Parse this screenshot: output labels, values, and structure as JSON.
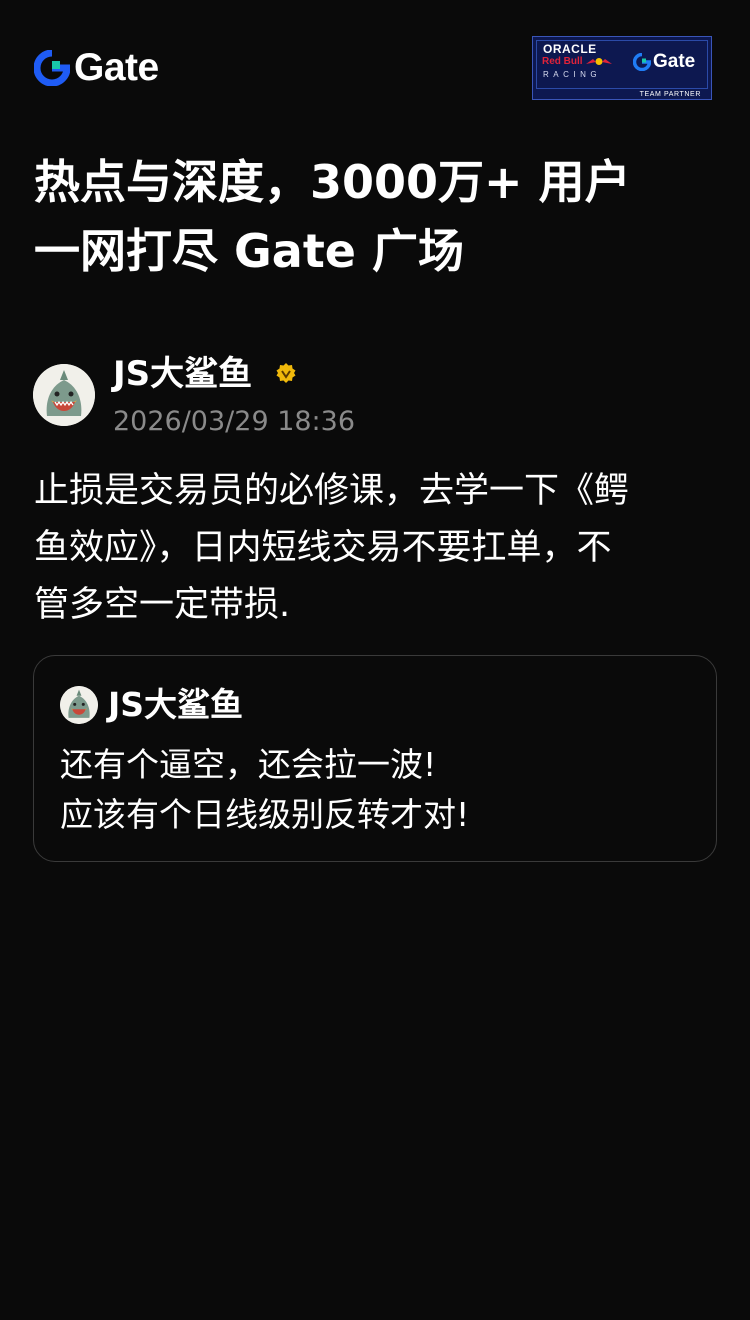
{
  "header": {
    "logo_text": "Gate",
    "partner_badge": {
      "line1": "ORACLE",
      "line2": "Red Bull",
      "line3": "RACING",
      "brand": "Gate",
      "caption": "TEAM PARTNER"
    }
  },
  "headline": {
    "line1": "热点与深度，3000万+ 用户",
    "line2": "一网打尽 Gate 广场"
  },
  "post": {
    "author_name": "JS大鲨鱼",
    "timestamp": "2026/03/29 18:36",
    "body_lines": [
      "止损是交易员的必修课，去学一下《鳄",
      "鱼效应》，日内短线交易不要扛单，不",
      "管多空一定带损."
    ],
    "quoted": {
      "author_name": "JS大鲨鱼",
      "lines": [
        "还有个逼空，还会拉一波!",
        "应该有个日线级别反转才对!"
      ]
    }
  },
  "colors": {
    "background": "#0a0a0a",
    "text_primary": "#ffffff",
    "text_secondary": "#8a8a8a",
    "brand_blue": "#1f5cf5",
    "brand_teal": "#19c8a8",
    "verified_gold": "#f0b90b",
    "card_border": "#3a3a3a"
  },
  "icons": {
    "logo": "gate-logo-icon",
    "verified": "verified-badge-icon",
    "avatar": "shark-avatar"
  }
}
